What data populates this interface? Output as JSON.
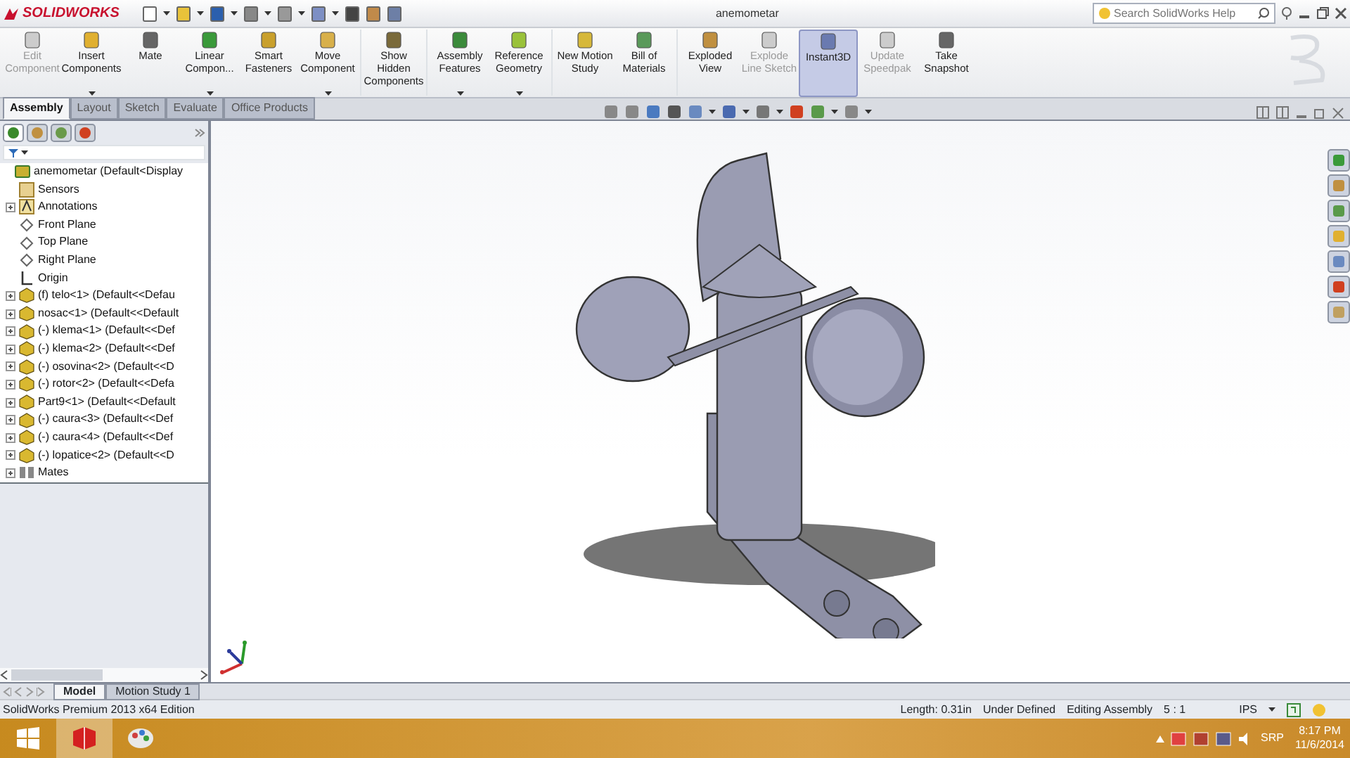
{
  "app": {
    "logo": "SOLIDWORKS",
    "title": "anemometar",
    "search": {
      "placeholder": "Search SolidWorks Help"
    }
  },
  "ribbon": [
    {
      "label": "Edit Component",
      "disabled": true,
      "dropdown": false,
      "selected": false
    },
    {
      "label": "Insert Components",
      "disabled": false,
      "dropdown": true,
      "selected": false
    },
    {
      "label": "Mate",
      "disabled": false,
      "dropdown": false,
      "selected": false
    },
    {
      "label": "Linear Compon...",
      "disabled": false,
      "dropdown": true,
      "selected": false
    },
    {
      "label": "Smart Fasteners",
      "disabled": false,
      "dropdown": false,
      "selected": false
    },
    {
      "label": "Move Component",
      "disabled": false,
      "dropdown": true,
      "selected": false
    },
    {
      "label": "Show Hidden Components",
      "disabled": false,
      "dropdown": false,
      "selected": false
    },
    {
      "label": "Assembly Features",
      "disabled": false,
      "dropdown": true,
      "selected": false
    },
    {
      "label": "Reference Geometry",
      "disabled": false,
      "dropdown": true,
      "selected": false
    },
    {
      "label": "New Motion Study",
      "disabled": false,
      "dropdown": false,
      "selected": false
    },
    {
      "label": "Bill of Materials",
      "disabled": false,
      "dropdown": false,
      "selected": false
    },
    {
      "label": "Exploded View",
      "disabled": false,
      "dropdown": false,
      "selected": false
    },
    {
      "label": "Explode Line Sketch",
      "disabled": true,
      "dropdown": false,
      "selected": false
    },
    {
      "label": "Instant3D",
      "disabled": false,
      "dropdown": false,
      "selected": true
    },
    {
      "label": "Update Speedpak",
      "disabled": true,
      "dropdown": false,
      "selected": false
    },
    {
      "label": "Take Snapshot",
      "disabled": false,
      "dropdown": false,
      "selected": false
    }
  ],
  "tabs": [
    {
      "label": "Assembly",
      "selected": true
    },
    {
      "label": "Layout",
      "selected": false
    },
    {
      "label": "Sketch",
      "selected": false
    },
    {
      "label": "Evaluate",
      "selected": false
    },
    {
      "label": "Office Products",
      "selected": false
    }
  ],
  "feature_tree": {
    "label": "anemometar  (Default<Display",
    "kind": "assembly",
    "expandable": false,
    "children": [
      {
        "label": "Sensors",
        "kind": "sensors",
        "expandable": false
      },
      {
        "label": "Annotations",
        "kind": "annotations",
        "expandable": true
      },
      {
        "label": "Front Plane",
        "kind": "plane",
        "expandable": false
      },
      {
        "label": "Top Plane",
        "kind": "plane",
        "expandable": false
      },
      {
        "label": "Right Plane",
        "kind": "plane",
        "expandable": false
      },
      {
        "label": "Origin",
        "kind": "origin",
        "expandable": false
      },
      {
        "label": "(f) telo<1> (Default<<Defau",
        "kind": "part",
        "expandable": true
      },
      {
        "label": "nosac<1> (Default<<Default",
        "kind": "part",
        "expandable": true
      },
      {
        "label": "(-) klema<1> (Default<<Def",
        "kind": "part",
        "expandable": true
      },
      {
        "label": "(-) klema<2> (Default<<Def",
        "kind": "part",
        "expandable": true
      },
      {
        "label": "(-) osovina<2> (Default<<D",
        "kind": "part",
        "expandable": true
      },
      {
        "label": "(-) rotor<2> (Default<<Defa",
        "kind": "part",
        "expandable": true
      },
      {
        "label": "Part9<1> (Default<<Default",
        "kind": "part",
        "expandable": true
      },
      {
        "label": "(-) caura<3> (Default<<Def",
        "kind": "part",
        "expandable": true
      },
      {
        "label": "(-) caura<4> (Default<<Def",
        "kind": "part",
        "expandable": true
      },
      {
        "label": "(-) lopatice<2> (Default<<D",
        "kind": "part",
        "expandable": true
      },
      {
        "label": "Mates",
        "kind": "mates",
        "expandable": true
      }
    ]
  },
  "bottom_tabs": [
    {
      "label": "Model",
      "selected": true
    },
    {
      "label": "Motion Study 1",
      "selected": false
    }
  ],
  "status_bar": {
    "edition": "SolidWorks Premium 2013 x64 Edition",
    "items": [
      "Length: 0.31in",
      "Under Defined",
      "Editing Assembly",
      "5 : 1",
      "IPS"
    ]
  },
  "taskbar": {
    "language": "SRP",
    "time": "8:17 PM",
    "date": "11/6/2014"
  }
}
